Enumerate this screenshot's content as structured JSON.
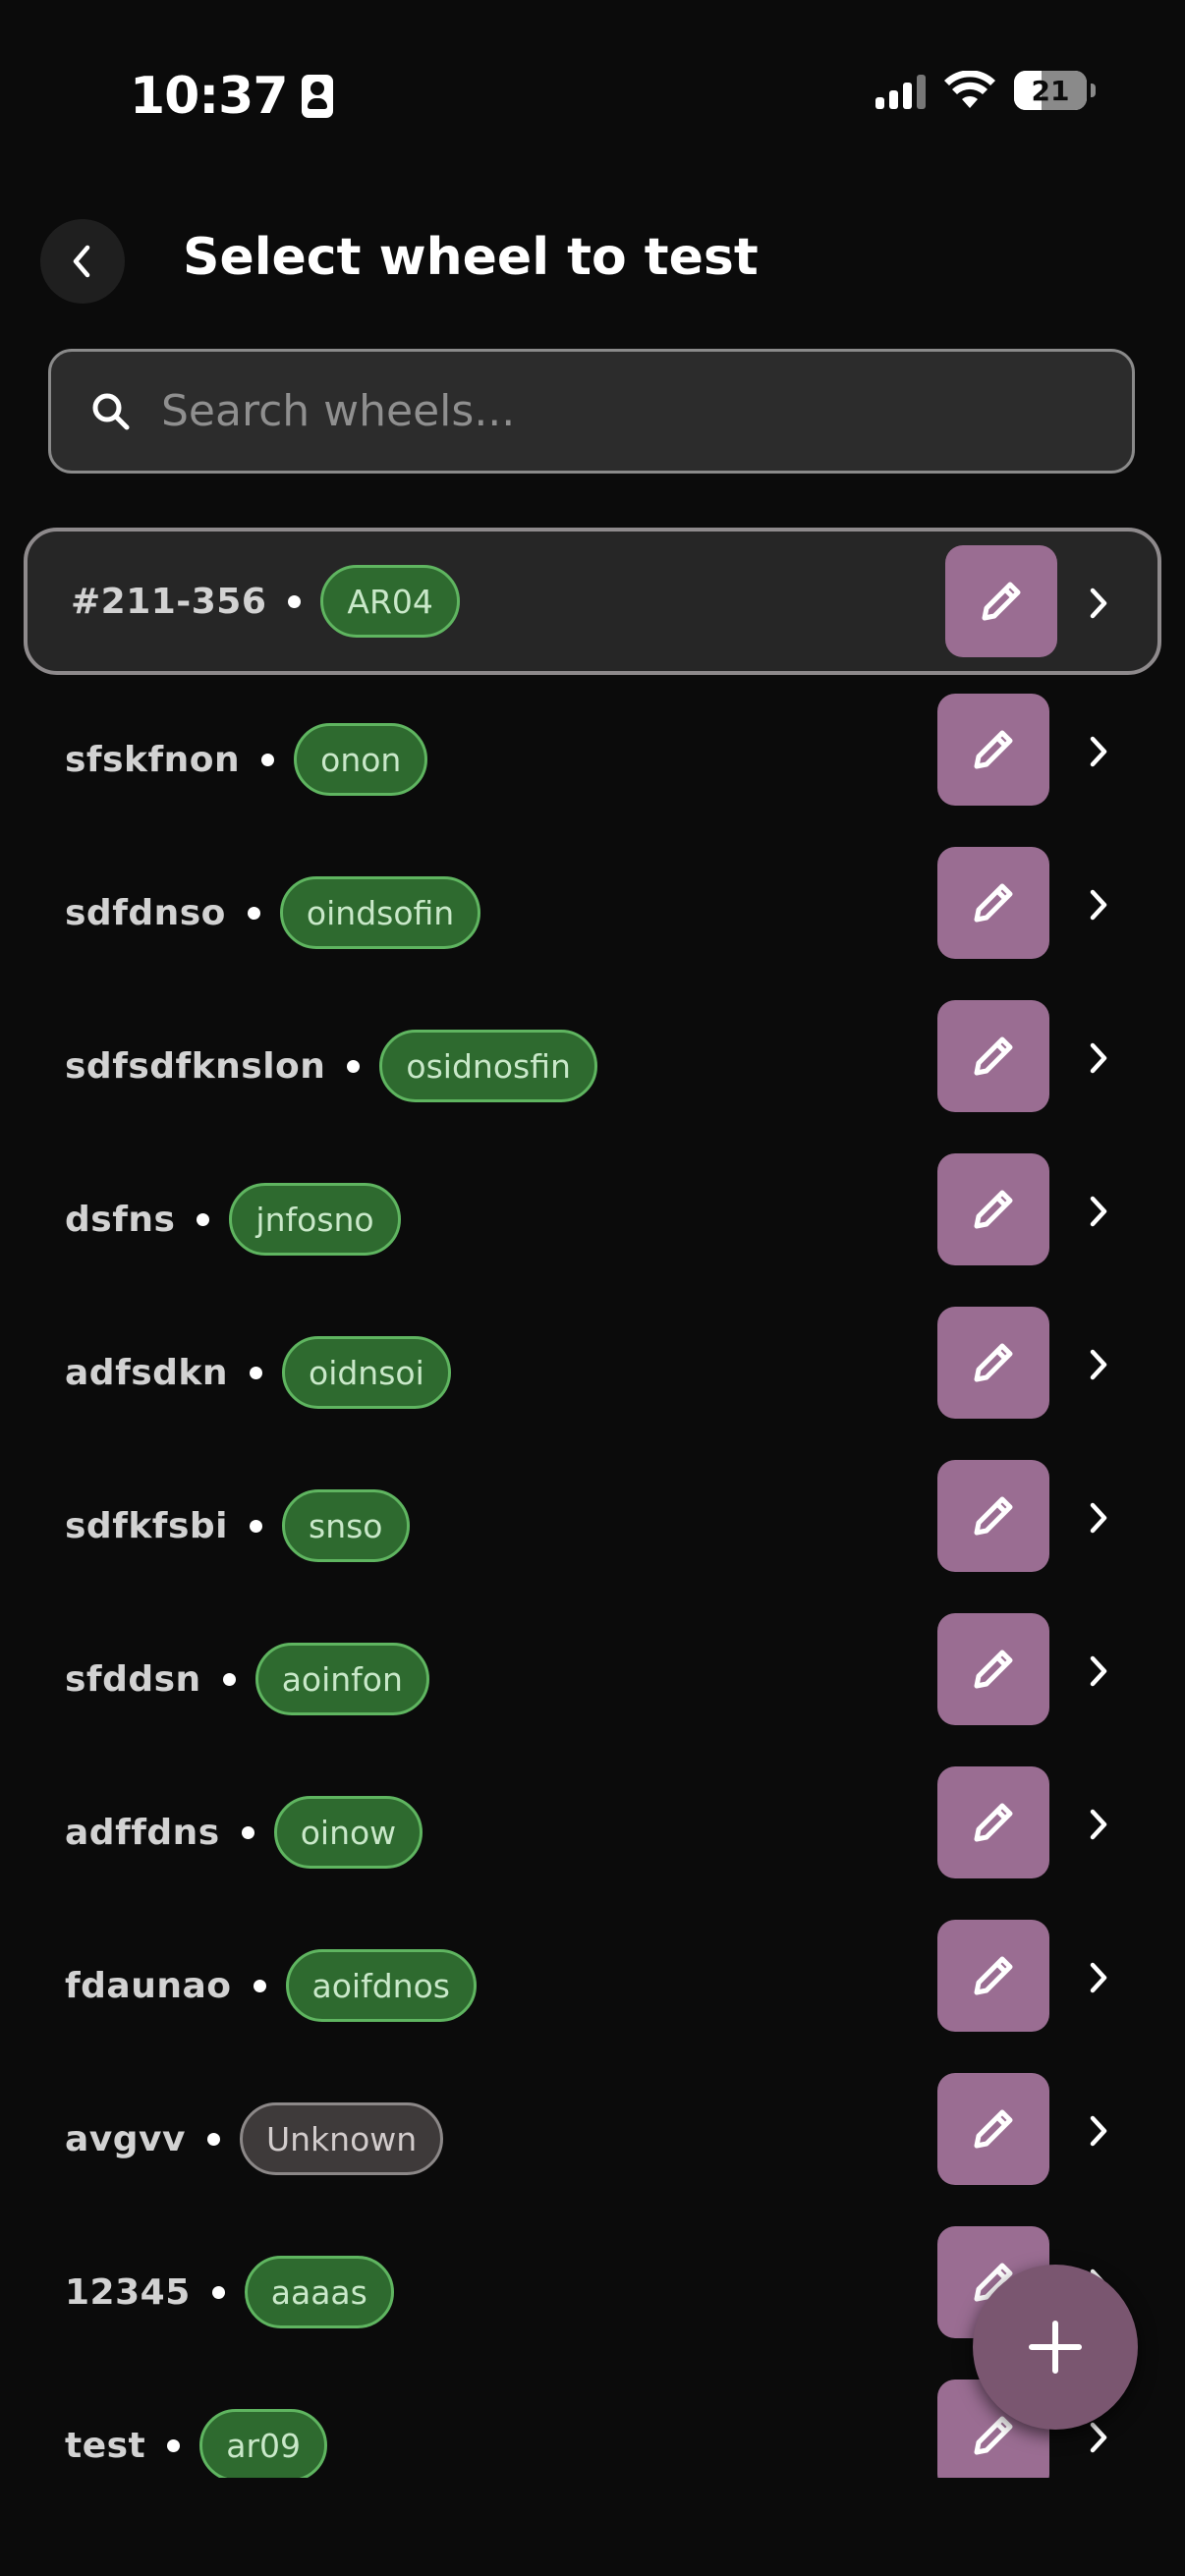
{
  "status_bar": {
    "time": "10:37",
    "battery": "21"
  },
  "header": {
    "title": "Select wheel to test"
  },
  "search": {
    "placeholder": "Search wheels..."
  },
  "wheels": [
    {
      "name": "#211-356",
      "tag": "AR04",
      "tag_type": "known",
      "selected": true
    },
    {
      "name": "sfskfnon",
      "tag": "onon",
      "tag_type": "known"
    },
    {
      "name": "sdfdnso",
      "tag": "oindsofin",
      "tag_type": "known"
    },
    {
      "name": "sdfsdfknslon",
      "tag": "osidnosfin",
      "tag_type": "known"
    },
    {
      "name": "dsfns",
      "tag": "jnfosno",
      "tag_type": "known"
    },
    {
      "name": "adfsdkn",
      "tag": "oidnsoi",
      "tag_type": "known"
    },
    {
      "name": "sdfkfsbi",
      "tag": "snso",
      "tag_type": "known"
    },
    {
      "name": "sfddsn",
      "tag": "aoinfon",
      "tag_type": "known"
    },
    {
      "name": "adffdns",
      "tag": "oinow",
      "tag_type": "known"
    },
    {
      "name": "fdaunao",
      "tag": "aoifdnos",
      "tag_type": "known"
    },
    {
      "name": "avgvv",
      "tag": "Unknown",
      "tag_type": "unknown"
    },
    {
      "name": "12345",
      "tag": "aaaas",
      "tag_type": "known"
    },
    {
      "name": "test",
      "tag": "ar09",
      "tag_type": "known"
    }
  ],
  "colors": {
    "background": "#0b0b0b",
    "edit_button": "#9a6d92",
    "tag_green": "#2e6a2f",
    "fab": "#7a5670"
  },
  "icons": {
    "back": "chevron-left-icon",
    "search": "search-icon",
    "edit": "pencil-icon",
    "open": "chevron-right-icon",
    "add": "plus-icon"
  }
}
